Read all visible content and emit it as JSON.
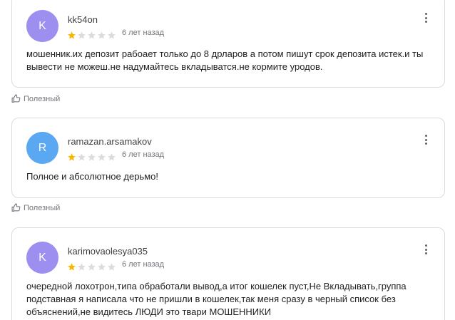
{
  "colors": {
    "star_filled": "#f6b800",
    "star_empty": "#dadce0"
  },
  "reviews": [
    {
      "avatar_letter": "K",
      "avatar_color": "#9c8ff0",
      "username": "kk54on",
      "rating": 1,
      "max_rating": 5,
      "time": "6 лет назад",
      "text": "мошенник.их депозит рабоает только до 8 дрларов а потом пишут срок депозита истек.и ты вывести не можеш.не надумайтесь вкладыватся.не кормите уродов.",
      "helpful_label": "Полезный"
    },
    {
      "avatar_letter": "R",
      "avatar_color": "#5aa8f2",
      "username": "ramazan.arsamakov",
      "rating": 1,
      "max_rating": 5,
      "time": "6 лет назад",
      "text": "Полное и абсолютное дерьмо!",
      "helpful_label": "Полезный"
    },
    {
      "avatar_letter": "K",
      "avatar_color": "#9c8ff0",
      "username": "karimovaolesya035",
      "rating": 1,
      "max_rating": 5,
      "time": "6 лет назад",
      "text": "очередной лохотрон,типа обработали вывод,а итог кошелек пуст,Не Вкладывать,группа подставная я написала что не пришли в кошелек,так меня сразу в черный список без объяснений,не видитесь ЛЮДИ  это твари МОШЕННИКИ"
    }
  ]
}
